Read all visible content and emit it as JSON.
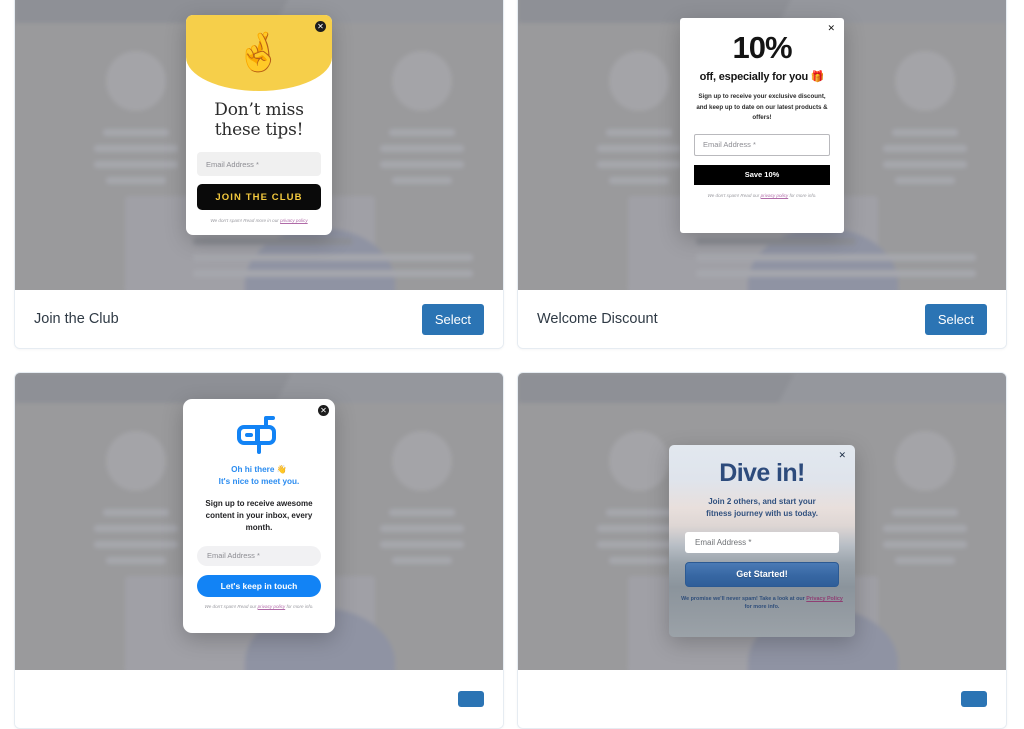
{
  "gallery": {
    "cards": [
      {
        "title": "Join the Club",
        "select_label": "Select",
        "popup": {
          "kind": "join-the-club",
          "emoji": "🤞",
          "heading_line1": "Don’t miss",
          "heading_line2": "these tips!",
          "email_placeholder": "Email Address *",
          "button_label": "JOIN THE CLUB",
          "fineprint_before": "We don't spam! Read more in our ",
          "fineprint_link": "privacy policy",
          "fineprint_after": "",
          "close_icon": "close-icon",
          "accent": "#f6cf4a",
          "button_bg": "#0a0a0a",
          "button_color": "#f4ca3e"
        }
      },
      {
        "title": "Welcome Discount",
        "select_label": "Select",
        "popup": {
          "kind": "welcome-discount",
          "big_number": "10%",
          "subheading": "off, especially for you 🎁",
          "body": "Sign up to receive your exclusive discount, and keep up to date on our latest products & offers!",
          "email_placeholder": "Email Address *",
          "button_label": "Save 10%",
          "fineprint_before": "We don't spam! Read our ",
          "fineprint_link": "privacy policy",
          "fineprint_after": " for more info.",
          "close_icon": "close-icon",
          "button_bg": "#000000",
          "button_color": "#ffffff"
        }
      },
      {
        "title": "",
        "select_label": "",
        "popup": {
          "kind": "keep-in-touch",
          "icon": "mailbox-icon",
          "heading_line1": "Oh hi there 👋",
          "heading_line2": "It's nice to meet you.",
          "body": "Sign up to receive awesome content in your inbox, every month.",
          "email_placeholder": "Email Address *",
          "button_label": "Let's keep in touch",
          "fineprint_before": "We don't spam! Read our ",
          "fineprint_link": "privacy policy",
          "fineprint_after": " for more info.",
          "close_icon": "close-icon",
          "accent": "#1283f5"
        }
      },
      {
        "title": "",
        "select_label": "",
        "popup": {
          "kind": "dive-in",
          "title": "Dive in!",
          "body_line1": "Join 2 others, and start your",
          "body_line2": "fitness journey with us today.",
          "email_placeholder": "Email Address *",
          "button_label": "Get Started!",
          "fineprint_before": "We promise we'll never spam! Take a look at our ",
          "fineprint_link": "Privacy Policy",
          "fineprint_after": " for more info.",
          "close_icon": "close-icon",
          "accent": "#3767a3"
        }
      }
    ]
  }
}
